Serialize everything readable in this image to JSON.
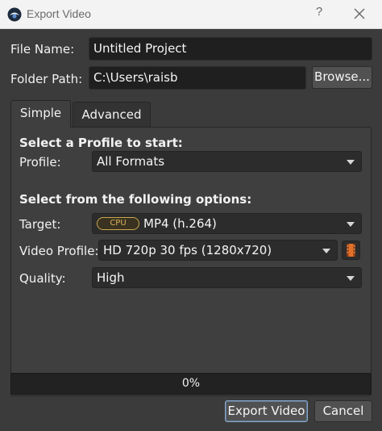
{
  "window": {
    "title": "Export Video",
    "help_glyph": "?",
    "close_glyph": "✕"
  },
  "form": {
    "file_name_label": "File Name:",
    "file_name_value": "Untitled Project",
    "folder_path_label": "Folder Path:",
    "folder_path_value": "C:\\Users\\raisb",
    "browse_label": "Browse..."
  },
  "tabs": [
    {
      "label": "Simple",
      "active": true
    },
    {
      "label": "Advanced",
      "active": false
    }
  ],
  "simple": {
    "profile_heading": "Select a Profile to start:",
    "profile_label": "Profile:",
    "profile_value": "All Formats",
    "options_heading": "Select from the following options:",
    "target_label": "Target:",
    "target_badge": "CPU",
    "target_value": "MP4 (h.264)",
    "video_profile_label": "Video Profile:",
    "video_profile_value": "HD 720p 30 fps (1280x720)",
    "quality_label": "Quality:",
    "quality_value": "High"
  },
  "progress": {
    "value": 0,
    "text": "0%"
  },
  "actions": {
    "export_label": "Export Video",
    "cancel_label": "Cancel"
  },
  "colors": {
    "background": "#3b3b3b",
    "field": "#1f1f1f",
    "accent": "#8aa8c8",
    "cpu_badge": "#c9a64e",
    "film_icon": "#e0702a"
  },
  "icons": {
    "app": "openshot-logo-icon",
    "film": "film-strip-icon"
  }
}
